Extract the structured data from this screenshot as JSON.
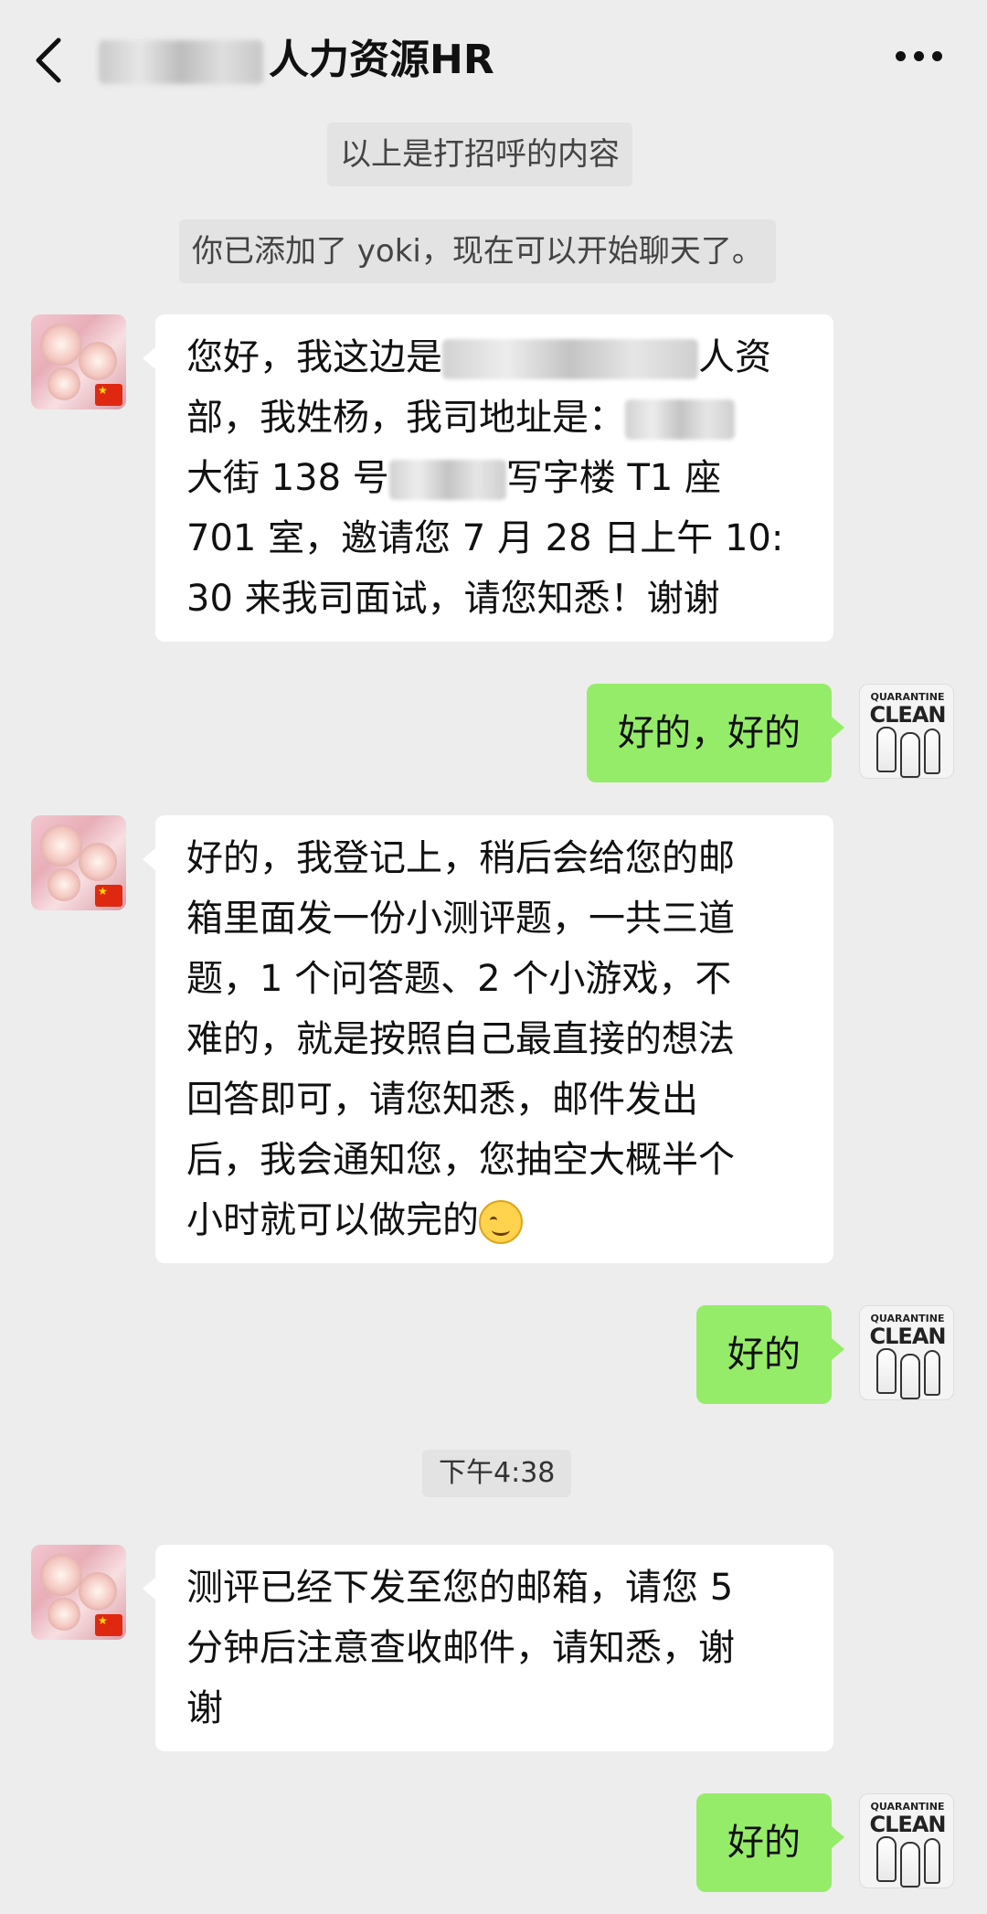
{
  "header": {
    "title_visible": "人力资源HR",
    "back_icon": "chevron-left-icon",
    "more_icon": "more-dots-icon"
  },
  "notices": {
    "greeting": "以上是打招呼的内容",
    "added": "你已添加了 yoki，现在可以开始聊天了。",
    "timestamp": "下午4:38"
  },
  "messages": [
    {
      "from": "hr",
      "lines": [
        "您好，我这边是",
        "人资",
        "部，我姓杨，我司地址是：",
        "大街 138 号",
        "写字楼 T1 座",
        "701 室，邀请您 7 月 28 日上午 10:",
        "30 来我司面试，请您知悉！谢谢"
      ]
    },
    {
      "from": "me",
      "text": "好的，好的"
    },
    {
      "from": "hr",
      "lines": [
        "好的，我登记上，稍后会给您的邮",
        "箱里面发一份小测评题，一共三道",
        "题，1 个问答题、2 个小游戏，不",
        "难的，就是按照自己最直接的想法",
        "回答即可，请您知悉，邮件发出",
        "后，我会通知您，您抽空大概半个",
        "小时就可以做完的"
      ]
    },
    {
      "from": "me",
      "text": "好的"
    },
    {
      "from": "hr",
      "lines": [
        "测评已经下发至您的邮箱，请您 5",
        "分钟后注意查收邮件，请知悉，谢",
        "谢"
      ]
    },
    {
      "from": "me",
      "text": "好的"
    }
  ],
  "avatars": {
    "me_text_small": "QUARANTINE",
    "me_text_big": "CLEAN"
  }
}
